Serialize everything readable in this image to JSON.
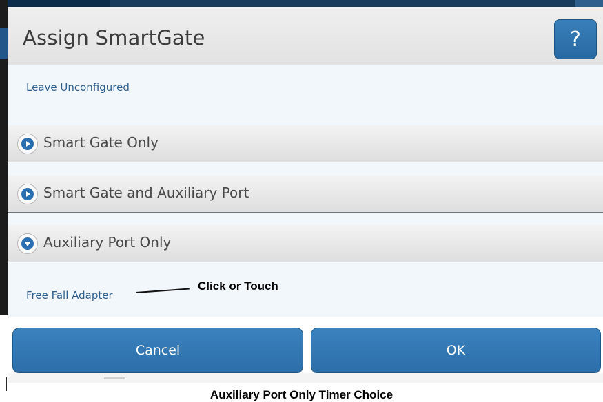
{
  "dialog": {
    "title": "Assign SmartGate",
    "help_label": "?",
    "leave_unconfigured": "Leave Unconfigured",
    "sections": [
      {
        "label": "Smart Gate Only",
        "expanded": false
      },
      {
        "label": "Smart Gate and Auxiliary Port",
        "expanded": false
      },
      {
        "label": "Auxiliary Port Only",
        "expanded": true
      }
    ],
    "aux_items": [
      "Free Fall Adapter"
    ],
    "cancel_label": "Cancel",
    "ok_label": "OK"
  },
  "annotation": {
    "text": "Click or Touch"
  },
  "caption": "Auxiliary Port Only Timer Choice",
  "colors": {
    "accent": "#2c6ea8",
    "link": "#2f5f8f",
    "panel_bg": "#f2f7fc"
  },
  "icons": {
    "collapsed": "play-circle-icon",
    "expanded": "chevron-down-circle-icon"
  }
}
